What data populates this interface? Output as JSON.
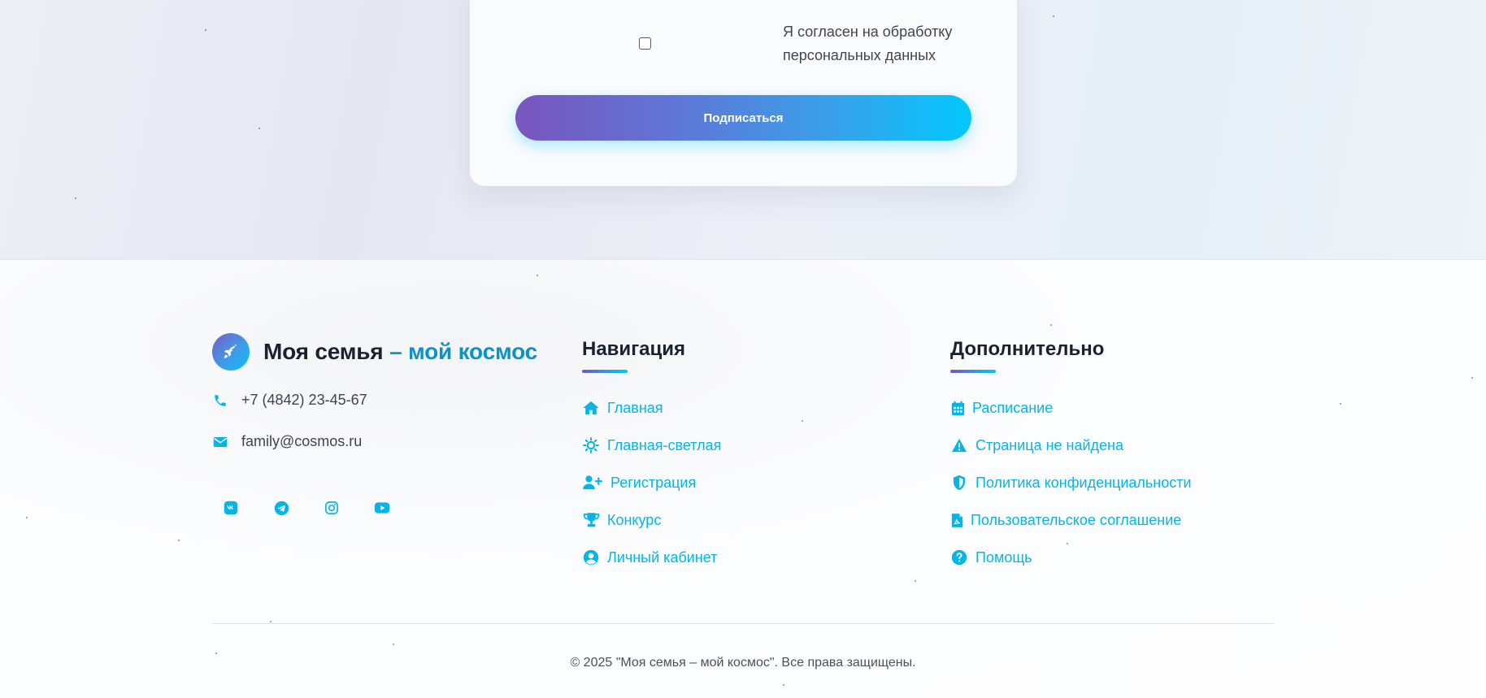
{
  "subscription": {
    "consent_label": "Я согласен на обработку персональных данных",
    "subscribe_button": "Подписаться"
  },
  "footer": {
    "brand": {
      "title_main": "Моя семья",
      "title_accent": "– мой космос",
      "logo_icon": "rocket-icon"
    },
    "contacts": {
      "phone": "+7 (4842) 23-45-67",
      "email": "family@cosmos.ru"
    },
    "socials": [
      {
        "name": "vk-icon"
      },
      {
        "name": "telegram-icon"
      },
      {
        "name": "instagram-icon"
      },
      {
        "name": "youtube-icon"
      }
    ],
    "navigation": {
      "heading": "Навигация",
      "items": [
        {
          "label": "Главная",
          "icon": "home-icon"
        },
        {
          "label": "Главная-светлая",
          "icon": "sun-icon"
        },
        {
          "label": "Регистрация",
          "icon": "user-plus-icon"
        },
        {
          "label": "Конкурс",
          "icon": "trophy-icon"
        },
        {
          "label": "Личный кабинет",
          "icon": "user-circle-icon"
        }
      ]
    },
    "extra": {
      "heading": "Дополнительно",
      "items": [
        {
          "label": "Расписание",
          "icon": "calendar-icon"
        },
        {
          "label": "Страница не найдена",
          "icon": "warning-icon"
        },
        {
          "label": "Политика конфиденциальности",
          "icon": "shield-icon"
        },
        {
          "label": "Пользовательское соглашение",
          "icon": "document-icon"
        },
        {
          "label": "Помощь",
          "icon": "question-circle-icon"
        }
      ]
    },
    "copyright": "© 2025 \"Моя семья – мой космос\". Все права защищены."
  },
  "colors": {
    "accent_cyan": "#06b4e6",
    "accent_purple": "#7a55bd",
    "brand_accent": "#0c93c6"
  }
}
